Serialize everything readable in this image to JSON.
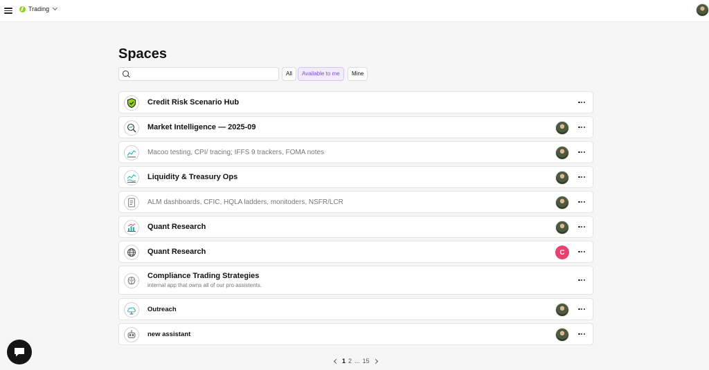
{
  "header": {
    "workspace_name": "Trading",
    "menu_icon": "hamburger-menu-icon",
    "avatar_icon": "user-avatar"
  },
  "page": {
    "title": "Spaces"
  },
  "search": {
    "placeholder": "",
    "value": ""
  },
  "filters": {
    "all": "All",
    "available": "Available to me",
    "mine": "Mine",
    "active": "available",
    "active_color": "#7b52c9"
  },
  "spaces": [
    {
      "title": "Credit Risk Scenario Hub",
      "subtitle": "",
      "icon": "shield-icon",
      "owner": "none"
    },
    {
      "title": "Market Intelligence — 2025-09",
      "subtitle": "",
      "icon": "magnifier-chart-icon",
      "owner": "avatar"
    },
    {
      "title": "Macoo testing, CPI/ tracing; IFFS 9  trackers, FOMA notes",
      "subtitle": "",
      "icon": "line-chart-icon",
      "owner": "avatar"
    },
    {
      "title": "Liquidity & Treasury Ops",
      "subtitle": "",
      "icon": "waves-chart-icon",
      "owner": "avatar"
    },
    {
      "title": "ALM dashboards, CFIC, HQLA ladders, monitoders, NSFR/LCR",
      "subtitle": "",
      "icon": "document-list-icon",
      "owner": "avatar"
    },
    {
      "title": "Quant Research",
      "subtitle": "",
      "icon": "bar-chart-icon",
      "owner": "avatar"
    },
    {
      "title": "Quant Research",
      "subtitle": "",
      "icon": "globe-icon",
      "owner": "letter",
      "owner_letter": "C",
      "owner_color": "#e8406f"
    },
    {
      "title": "Compliance Trading Strategies",
      "subtitle": "internal app that owns all of our pro assistents.",
      "icon": "brain-icon",
      "owner": "none"
    },
    {
      "title": "Outreach",
      "subtitle": "",
      "icon": "cloud-network-icon",
      "owner": "avatar"
    },
    {
      "title": "new assistant",
      "subtitle": "",
      "icon": "robot-icon",
      "owner": "avatar"
    }
  ],
  "pagination": {
    "current": "1",
    "second": "2",
    "ellipsis": "...",
    "last": "15"
  },
  "chat": {
    "icon": "chat-bubble-icon"
  }
}
